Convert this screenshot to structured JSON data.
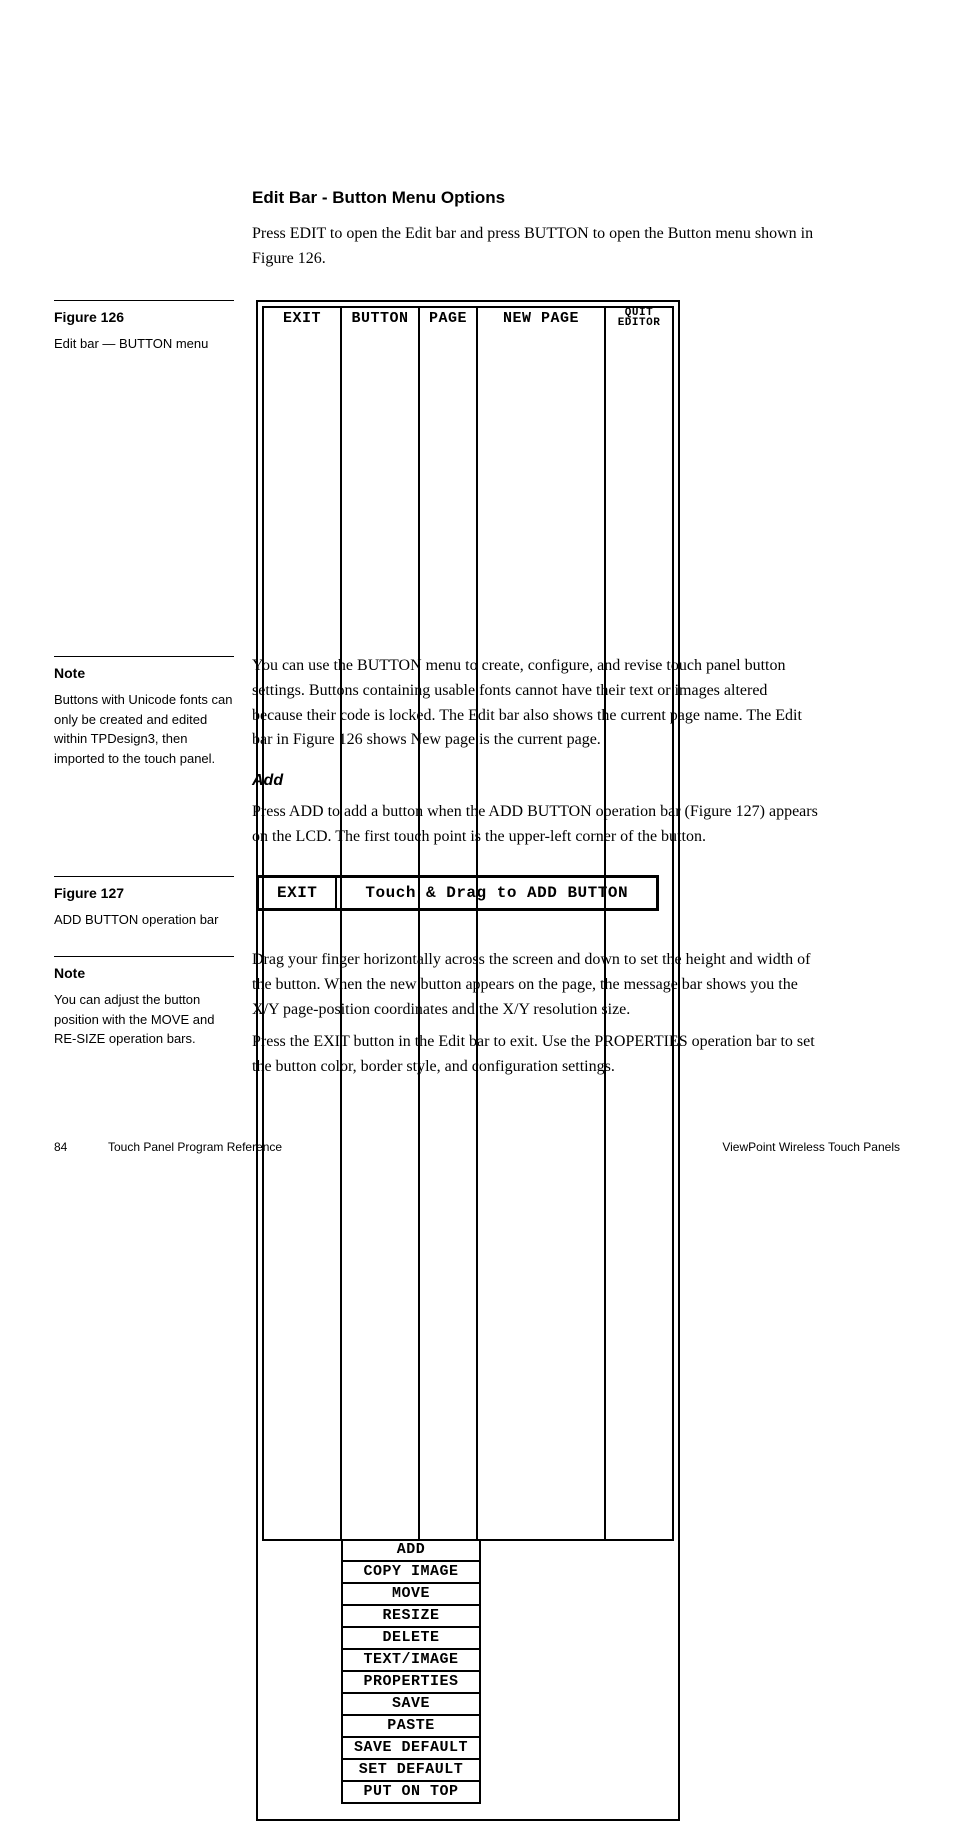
{
  "heading": "Edit Bar - Button Menu Options",
  "intro": "Press EDIT to open the Edit bar and press BUTTON to open the Button menu shown in Figure 126.",
  "fig126": {
    "label_title": "Figure 126",
    "label_caption": "Edit bar — BUTTON menu",
    "top": {
      "exit": "EXIT",
      "button": "BUTTON",
      "page": "PAGE",
      "new_page": "NEW PAGE",
      "quit": "QUIT\nEDITOR"
    },
    "menu": [
      "ADD",
      "COPY IMAGE",
      "MOVE",
      "RESIZE",
      "DELETE",
      "TEXT/IMAGE",
      "PROPERTIES",
      "SAVE",
      "PASTE",
      "SAVE DEFAULT",
      "SET DEFAULT",
      "PUT ON TOP"
    ]
  },
  "para_after_fig126": "You can use the BUTTON menu to create, configure, and revise touch panel button settings. Buttons containing usable fonts cannot have their text or images altered because their code is locked. The Edit bar also shows the current page name. The Edit bar in Figure 126 shows New page is the current page.",
  "note1": {
    "title": "Note",
    "body": "Buttons with Unicode fonts can only be created and edited within TPDesign3, then imported to the touch panel."
  },
  "add_heading": "Add",
  "add_para": "Press ADD to add a button when the ADD BUTTON operation bar (Figure 127) appears on the LCD. The first touch point is the upper-left corner of the button.",
  "fig127": {
    "label_title": "Figure 127",
    "label_caption": "ADD BUTTON operation bar",
    "exit": "EXIT",
    "msg": "Touch & Drag to ADD BUTTON"
  },
  "note2": {
    "title": "Note",
    "body": "You can adjust the button position with the MOVE and RE-SIZE operation bars."
  },
  "para_after_fig127a": "Drag your finger horizontally across the screen and down to set the height and width of the button. When the new button appears on the page, the message bar shows you the X/Y page-position coordinates and the X/Y resolution size.",
  "para_after_fig127b": "Press the EXIT button in the Edit bar to exit. Use the PROPERTIES operation bar to set the button color, border style, and configuration settings.",
  "footer": {
    "page_number": "84",
    "reference": "Touch Panel Program Reference",
    "product": "ViewPoint Wireless Touch Panels"
  }
}
